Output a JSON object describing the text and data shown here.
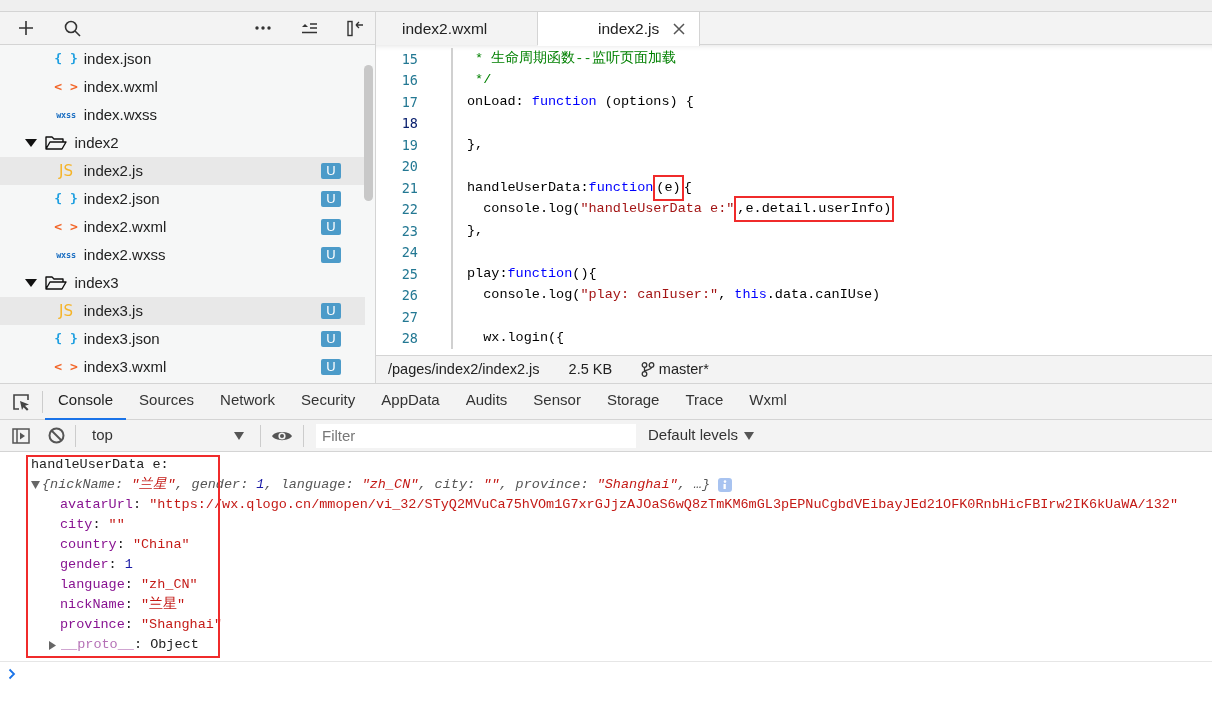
{
  "file_tree": [
    {
      "kind": "group",
      "children": [
        {
          "name": "index.json",
          "kind": "json",
          "icon": "{ }",
          "selected": false
        },
        {
          "name": "index.wxml",
          "kind": "wxml",
          "icon": "< >",
          "selected": false
        },
        {
          "name": "index.wxss",
          "kind": "wxss",
          "icon": "wxss",
          "selected": false
        }
      ]
    },
    {
      "name": "index2",
      "kind": "folder",
      "expanded": true,
      "children": [
        {
          "name": "index2.js",
          "kind": "js",
          "icon": "JS",
          "badge": "U",
          "selected": true
        },
        {
          "name": "index2.json",
          "kind": "json",
          "icon": "{ }",
          "badge": "U",
          "selected": false
        },
        {
          "name": "index2.wxml",
          "kind": "wxml",
          "icon": "< >",
          "badge": "U",
          "selected": false
        },
        {
          "name": "index2.wxss",
          "kind": "wxss",
          "icon": "wxss",
          "badge": "U",
          "selected": false
        }
      ]
    },
    {
      "name": "index3",
      "kind": "folder",
      "expanded": true,
      "children": [
        {
          "name": "index3.js",
          "kind": "js",
          "icon": "JS",
          "badge": "U",
          "selected": true
        },
        {
          "name": "index3.json",
          "kind": "json",
          "icon": "{ }",
          "badge": "U",
          "selected": false
        },
        {
          "name": "index3.wxml",
          "kind": "wxml",
          "icon": "< >",
          "badge": "U",
          "selected": false
        }
      ]
    }
  ],
  "editor_tabs": [
    {
      "label": "index2.wxml",
      "selected": false
    },
    {
      "label": "index2.js",
      "selected": true
    }
  ],
  "code_lines": [
    {
      "number": "15",
      "active": false,
      "tokens": [
        {
          "text": " * 生命周期函数--监听页面加载",
          "kind": "comment",
          "highlighted": false
        }
      ]
    },
    {
      "number": "16",
      "active": false,
      "tokens": [
        {
          "text": " */",
          "kind": "comment",
          "highlighted": false
        }
      ]
    },
    {
      "number": "17",
      "active": false,
      "tokens": [
        {
          "text": "onLoad: ",
          "kind": "plain",
          "highlighted": false
        },
        {
          "text": "function",
          "kind": "keyword",
          "highlighted": false
        },
        {
          "text": " (options) {",
          "kind": "plain",
          "highlighted": false
        }
      ]
    },
    {
      "number": "18",
      "active": true
    },
    {
      "number": "19",
      "active": false,
      "tokens": [
        {
          "text": "},",
          "kind": "plain",
          "highlighted": false
        }
      ]
    },
    {
      "number": "20",
      "active": false
    },
    {
      "number": "21",
      "active": false,
      "tokens": [
        {
          "text": "handleUserData:",
          "kind": "plain",
          "highlighted": false
        },
        {
          "text": "function",
          "kind": "keyword",
          "highlighted": false
        },
        {
          "text": "(e)",
          "kind": "plain",
          "highlighted": true
        },
        {
          "text": "{",
          "kind": "plain",
          "highlighted": false
        }
      ]
    },
    {
      "number": "22",
      "active": false,
      "tokens": [
        {
          "text": "  console.log(",
          "kind": "plain",
          "highlighted": false
        },
        {
          "text": "\"handleUserData e:\"",
          "kind": "string",
          "highlighted": false
        },
        {
          "text": ",e.detail.userInfo)",
          "kind": "plain",
          "highlighted": true
        }
      ]
    },
    {
      "number": "23",
      "active": false,
      "tokens": [
        {
          "text": "},",
          "kind": "plain",
          "highlighted": false
        }
      ]
    },
    {
      "number": "24",
      "active": false
    },
    {
      "number": "25",
      "active": false,
      "tokens": [
        {
          "text": "play:",
          "kind": "plain",
          "highlighted": false
        },
        {
          "text": "function",
          "kind": "keyword",
          "highlighted": false
        },
        {
          "text": "(){",
          "kind": "plain",
          "highlighted": false
        }
      ]
    },
    {
      "number": "26",
      "active": false,
      "tokens": [
        {
          "text": "  console.log(",
          "kind": "plain",
          "highlighted": false
        },
        {
          "text": "\"play: canIuser:\"",
          "kind": "string",
          "highlighted": false
        },
        {
          "text": ", ",
          "kind": "plain",
          "highlighted": false
        },
        {
          "text": "this",
          "kind": "keyword",
          "highlighted": false
        },
        {
          "text": ".data.canIUse)",
          "kind": "plain",
          "highlighted": false
        }
      ]
    },
    {
      "number": "27",
      "active": false
    },
    {
      "number": "28",
      "active": false,
      "tokens": [
        {
          "text": "  wx.login({",
          "kind": "plain",
          "highlighted": false
        }
      ]
    }
  ],
  "status_bar": {
    "path": "/pages/index2/index2.js",
    "size": "2.5 KB",
    "branch": "master*"
  },
  "devtools_tabs": [
    {
      "label": "Console",
      "selected": true
    },
    {
      "label": "Sources",
      "selected": false
    },
    {
      "label": "Network",
      "selected": false
    },
    {
      "label": "Security",
      "selected": false
    },
    {
      "label": "AppData",
      "selected": false
    },
    {
      "label": "Audits",
      "selected": false
    },
    {
      "label": "Sensor",
      "selected": false
    },
    {
      "label": "Storage",
      "selected": false
    },
    {
      "label": "Trace",
      "selected": false
    },
    {
      "label": "Wxml",
      "selected": false
    }
  ],
  "console_toolbar": {
    "context": "top",
    "filter_placeholder": "Filter",
    "levels": "Default levels"
  },
  "console": {
    "highlighted": true,
    "message": "handleUserData e:",
    "object": {
      "expanded": true,
      "preview": [
        {
          "text": "{nickName: ",
          "kind": "plain"
        },
        {
          "text": "\"兰星\"",
          "kind": "string"
        },
        {
          "text": ", gender: ",
          "kind": "plain"
        },
        {
          "text": "1",
          "kind": "number"
        },
        {
          "text": ", language: ",
          "kind": "plain"
        },
        {
          "text": "\"zh_CN\"",
          "kind": "string"
        },
        {
          "text": ", city: ",
          "kind": "plain"
        },
        {
          "text": "\"\"",
          "kind": "string"
        },
        {
          "text": ", province: ",
          "kind": "plain"
        },
        {
          "text": "\"Shanghai\"",
          "kind": "string"
        },
        {
          "text": ", …}",
          "kind": "plain"
        }
      ],
      "properties": [
        {
          "kind": "value",
          "tokens": [
            {
              "text": "avatarUrl",
              "kind": "key"
            },
            {
              "text": ": ",
              "kind": "plain"
            },
            {
              "text": "\"https://wx.qlogo.cn/mmopen/vi_32/STyQ2MVuCa75hVOm1G7xrGJjzAJOaS6wQ8zTmKM6mGL3pEPNuCgbdVEibayJEd21OFK0RnbHicFBIrw2IK6kUaWA/132\"",
              "kind": "string"
            }
          ]
        },
        {
          "kind": "value",
          "tokens": [
            {
              "text": "city",
              "kind": "key"
            },
            {
              "text": ": ",
              "kind": "plain"
            },
            {
              "text": "\"\"",
              "kind": "string"
            }
          ]
        },
        {
          "kind": "value",
          "tokens": [
            {
              "text": "country",
              "kind": "key"
            },
            {
              "text": ": ",
              "kind": "plain"
            },
            {
              "text": "\"China\"",
              "kind": "string"
            }
          ]
        },
        {
          "kind": "value",
          "tokens": [
            {
              "text": "gender",
              "kind": "key"
            },
            {
              "text": ": ",
              "kind": "plain"
            },
            {
              "text": "1",
              "kind": "number"
            }
          ]
        },
        {
          "kind": "value",
          "tokens": [
            {
              "text": "language",
              "kind": "key"
            },
            {
              "text": ": ",
              "kind": "plain"
            },
            {
              "text": "\"zh_CN\"",
              "kind": "string"
            }
          ]
        },
        {
          "kind": "value",
          "tokens": [
            {
              "text": "nickName",
              "kind": "key"
            },
            {
              "text": ": ",
              "kind": "plain"
            },
            {
              "text": "\"兰星\"",
              "kind": "string"
            }
          ]
        },
        {
          "kind": "value",
          "tokens": [
            {
              "text": "province",
              "kind": "key"
            },
            {
              "text": ": ",
              "kind": "plain"
            },
            {
              "text": "\"Shanghai\"",
              "kind": "string"
            }
          ]
        },
        {
          "kind": "object",
          "expanded": false,
          "tokens": [
            {
              "text": "__proto__",
              "kind": "proto"
            },
            {
              "text": ": ",
              "kind": "plain"
            },
            {
              "text": "Object",
              "kind": "plain"
            }
          ]
        }
      ]
    }
  }
}
